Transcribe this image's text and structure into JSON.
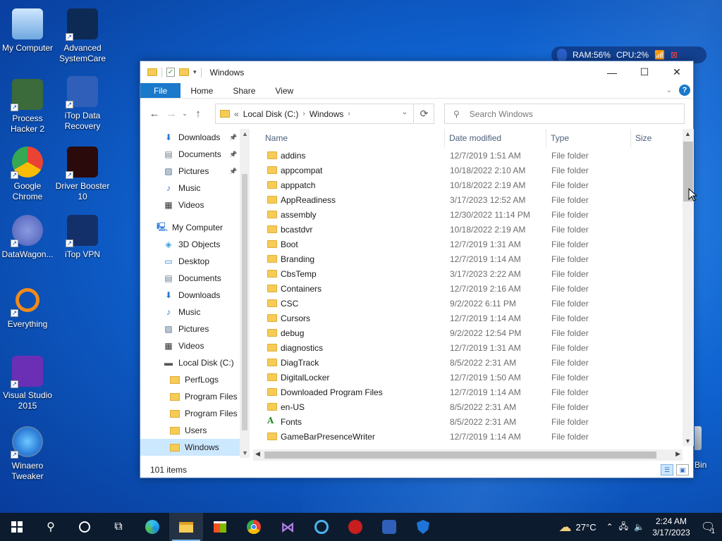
{
  "desktop": {
    "icons": [
      {
        "label": "My Computer",
        "icon": "monitor-icon"
      },
      {
        "label": "Advanced SystemCare",
        "icon": "advanced-systemcare-icon"
      },
      {
        "label": "Process Hacker 2",
        "icon": "process-hacker-icon"
      },
      {
        "label": "iTop Data Recovery",
        "icon": "itop-data-recovery-icon"
      },
      {
        "label": "Google Chrome",
        "icon": "chrome-icon"
      },
      {
        "label": "Driver Booster 10",
        "icon": "driver-booster-icon"
      },
      {
        "label": "DataWagon...",
        "icon": "datawagon-icon"
      },
      {
        "label": "iTop VPN",
        "icon": "itop-vpn-icon"
      },
      {
        "label": "Everything",
        "icon": "everything-search-icon"
      },
      {
        "label": "Visual Studio 2015",
        "icon": "visual-studio-icon"
      },
      {
        "label": "Winaero Tweaker",
        "icon": "winaero-tweaker-icon"
      }
    ],
    "recycle_bin_partial": "Bin"
  },
  "monitor_widget": {
    "ram": "RAM:56%",
    "cpu": "CPU:2%"
  },
  "window": {
    "title": "Windows",
    "ribbon_tabs": [
      "File",
      "Home",
      "Share",
      "View"
    ],
    "address": {
      "prefix": "«",
      "crumbs": [
        "Local Disk (C:)",
        "Windows"
      ]
    },
    "search_placeholder": "Search Windows",
    "nav_pane": [
      {
        "label": "Downloads",
        "icon": "download-arrow-icon",
        "pinned": true,
        "indent": 1
      },
      {
        "label": "Documents",
        "icon": "document-icon",
        "pinned": true,
        "indent": 1
      },
      {
        "label": "Pictures",
        "icon": "picture-icon",
        "pinned": true,
        "indent": 1
      },
      {
        "label": "Music",
        "icon": "music-note-icon",
        "pinned": false,
        "indent": 1
      },
      {
        "label": "Videos",
        "icon": "film-icon",
        "pinned": false,
        "indent": 1
      },
      {
        "label": "",
        "icon": "",
        "pinned": false,
        "indent": 0,
        "spacer": true
      },
      {
        "label": "My Computer",
        "icon": "monitor-icon",
        "pinned": false,
        "indent": 0
      },
      {
        "label": "3D Objects",
        "icon": "cube-icon",
        "pinned": false,
        "indent": 1
      },
      {
        "label": "Desktop",
        "icon": "desktop-icon",
        "pinned": false,
        "indent": 1
      },
      {
        "label": "Documents",
        "icon": "document-icon",
        "pinned": false,
        "indent": 1
      },
      {
        "label": "Downloads",
        "icon": "download-arrow-icon",
        "pinned": false,
        "indent": 1
      },
      {
        "label": "Music",
        "icon": "music-note-icon",
        "pinned": false,
        "indent": 1
      },
      {
        "label": "Pictures",
        "icon": "picture-icon",
        "pinned": false,
        "indent": 1
      },
      {
        "label": "Videos",
        "icon": "film-icon",
        "pinned": false,
        "indent": 1
      },
      {
        "label": "Local Disk (C:)",
        "icon": "drive-icon",
        "pinned": false,
        "indent": 1
      },
      {
        "label": "PerfLogs",
        "icon": "folder-icon",
        "pinned": false,
        "indent": 2
      },
      {
        "label": "Program Files",
        "icon": "folder-icon",
        "pinned": false,
        "indent": 2
      },
      {
        "label": "Program Files (",
        "icon": "folder-icon",
        "pinned": false,
        "indent": 2
      },
      {
        "label": "Users",
        "icon": "folder-icon",
        "pinned": false,
        "indent": 2
      },
      {
        "label": "Windows",
        "icon": "folder-icon",
        "pinned": false,
        "indent": 2,
        "selected": true
      }
    ],
    "columns": [
      "Name",
      "Date modified",
      "Type",
      "Size"
    ],
    "files": [
      {
        "name": "addins",
        "date": "12/7/2019 1:51 AM",
        "type": "File folder"
      },
      {
        "name": "appcompat",
        "date": "10/18/2022 2:10 AM",
        "type": "File folder"
      },
      {
        "name": "apppatch",
        "date": "10/18/2022 2:19 AM",
        "type": "File folder"
      },
      {
        "name": "AppReadiness",
        "date": "3/17/2023 12:52 AM",
        "type": "File folder"
      },
      {
        "name": "assembly",
        "date": "12/30/2022 11:14 PM",
        "type": "File folder"
      },
      {
        "name": "bcastdvr",
        "date": "10/18/2022 2:19 AM",
        "type": "File folder"
      },
      {
        "name": "Boot",
        "date": "12/7/2019 1:31 AM",
        "type": "File folder"
      },
      {
        "name": "Branding",
        "date": "12/7/2019 1:14 AM",
        "type": "File folder"
      },
      {
        "name": "CbsTemp",
        "date": "3/17/2023 2:22 AM",
        "type": "File folder"
      },
      {
        "name": "Containers",
        "date": "12/7/2019 2:16 AM",
        "type": "File folder"
      },
      {
        "name": "CSC",
        "date": "9/2/2022 6:11 PM",
        "type": "File folder"
      },
      {
        "name": "Cursors",
        "date": "12/7/2019 1:14 AM",
        "type": "File folder"
      },
      {
        "name": "debug",
        "date": "9/2/2022 12:54 PM",
        "type": "File folder"
      },
      {
        "name": "diagnostics",
        "date": "12/7/2019 1:31 AM",
        "type": "File folder"
      },
      {
        "name": "DiagTrack",
        "date": "8/5/2022 2:31 AM",
        "type": "File folder"
      },
      {
        "name": "DigitalLocker",
        "date": "12/7/2019 1:50 AM",
        "type": "File folder"
      },
      {
        "name": "Downloaded Program Files",
        "date": "12/7/2019 1:14 AM",
        "type": "File folder"
      },
      {
        "name": "en-US",
        "date": "8/5/2022 2:31 AM",
        "type": "File folder"
      },
      {
        "name": "Fonts",
        "date": "8/5/2022 2:31 AM",
        "type": "File folder",
        "fonts": true
      },
      {
        "name": "GameBarPresenceWriter",
        "date": "12/7/2019 1:14 AM",
        "type": "File folder"
      }
    ],
    "status": "101 items"
  },
  "taskbar": {
    "apps": [
      "start-icon",
      "search-icon",
      "cortana-icon",
      "task-view-icon",
      "edge-icon",
      "file-explorer-icon",
      "store-icon",
      "chrome-icon",
      "visual-studio-icon",
      "advanced-systemcare-icon",
      "driver-booster-icon",
      "itop-data-recovery-icon",
      "itop-vpn-icon"
    ],
    "weather": "27°C",
    "time": "2:24 AM",
    "date": "3/17/2023",
    "notification_count": "1"
  }
}
